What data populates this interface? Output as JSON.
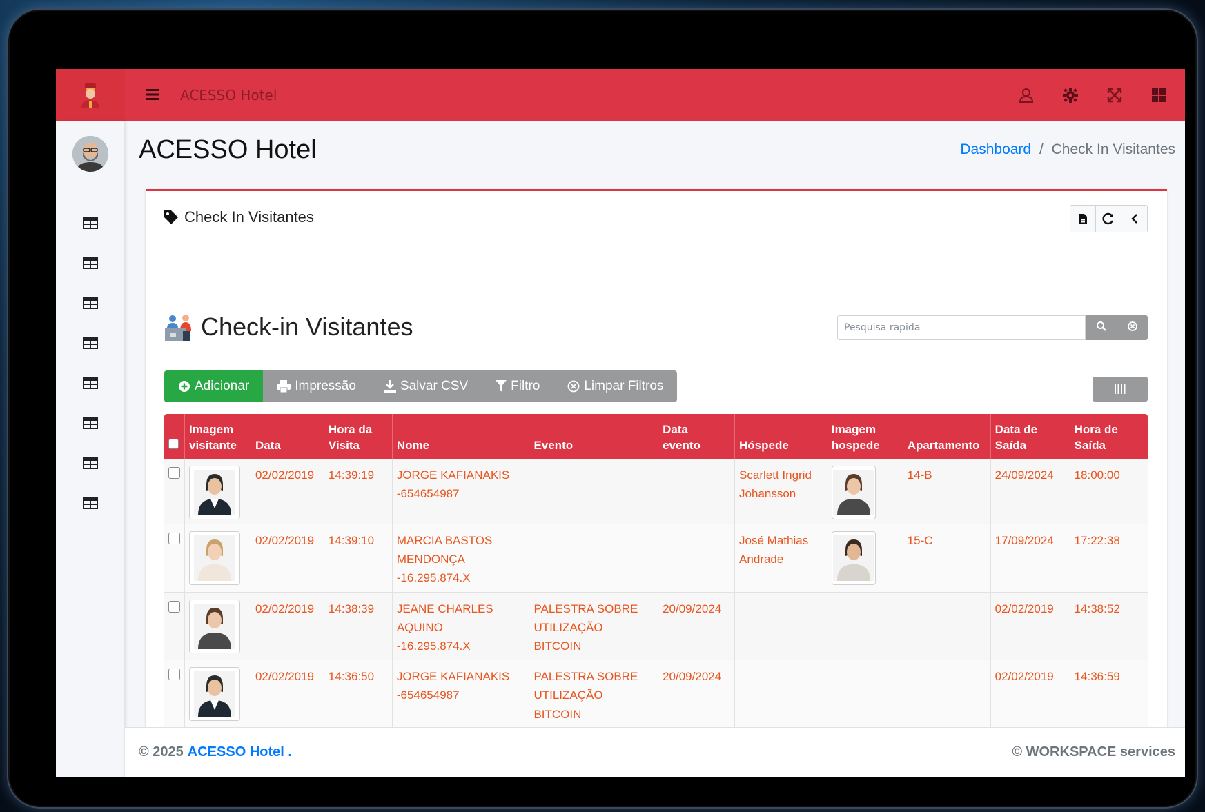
{
  "navbar": {
    "title": "ACESSO Hotel",
    "menu_icon": "hamburger-icon",
    "right_icons": [
      "user-icon",
      "gear-icon",
      "expand-icon",
      "apps-grid-icon"
    ],
    "accent": "#dc3545"
  },
  "sidebar": {
    "items": [
      "table-icon",
      "table-icon",
      "table-icon",
      "table-icon",
      "table-icon",
      "table-icon",
      "table-icon",
      "table-icon"
    ]
  },
  "header": {
    "title": "ACESSO Hotel",
    "breadcrumb": {
      "home": "Dashboard",
      "separator": "/",
      "current": "Check In Visitantes"
    }
  },
  "card": {
    "title": "Check In Visitantes",
    "tools": [
      "pdf-icon",
      "refresh-icon",
      "chevron-left-icon"
    ]
  },
  "grid": {
    "title": "Check-in Visitantes",
    "search": {
      "placeholder": "Pesquisa rapida"
    },
    "toolbar": {
      "add": "Adicionar",
      "print": "Impressão",
      "csv": "Salvar CSV",
      "filter": "Filtro",
      "clear": "Limpar Filtros"
    },
    "columns": [
      [
        "",
        ""
      ],
      [
        "Imagem",
        "visitante"
      ],
      [
        "",
        "Data"
      ],
      [
        "Hora da",
        "Visita"
      ],
      [
        "",
        "Nome"
      ],
      [
        "",
        "Evento"
      ],
      [
        "Data",
        "evento"
      ],
      [
        "",
        "Hóspede"
      ],
      [
        "Imagem",
        "hospede"
      ],
      [
        "",
        "Apartamento"
      ],
      [
        "Data de",
        "Saída"
      ],
      [
        "Hora de",
        "Saída"
      ]
    ],
    "rows": [
      {
        "data": "02/02/2019",
        "hora": "14:39:19",
        "nome": [
          "JORGE KAFIANAKIS",
          "-654654987"
        ],
        "evento": [],
        "data_evento": "",
        "hospede": [
          "Scarlett Ingrid",
          "Johansson"
        ],
        "apto": "14-B",
        "data_saida": "24/09/2024",
        "hora_saida": "18:00:00"
      },
      {
        "data": "02/02/2019",
        "hora": "14:39:10",
        "nome": [
          "MARCIA BASTOS",
          "MENDONÇA",
          "-16.295.874.X"
        ],
        "evento": [],
        "data_evento": "",
        "hospede": [
          "José Mathias",
          "Andrade"
        ],
        "apto": "15-C",
        "data_saida": "17/09/2024",
        "hora_saida": "17:22:38"
      },
      {
        "data": "02/02/2019",
        "hora": "14:38:39",
        "nome": [
          "JEANE CHARLES",
          "AQUINO",
          "-16.295.874.X"
        ],
        "evento": [
          "PALESTRA SOBRE",
          "UTILIZAÇÃO",
          "BITCOIN"
        ],
        "data_evento": "20/09/2024",
        "hospede": [],
        "apto": "",
        "data_saida": "02/02/2019",
        "hora_saida": "14:38:52"
      },
      {
        "data": "02/02/2019",
        "hora": "14:36:50",
        "nome": [
          "JORGE KAFIANAKIS",
          "-654654987"
        ],
        "evento": [
          "PALESTRA SOBRE",
          "UTILIZAÇÃO",
          "BITCOIN"
        ],
        "data_evento": "20/09/2024",
        "hospede": [],
        "apto": "",
        "data_saida": "02/02/2019",
        "hora_saida": "14:36:59"
      }
    ]
  },
  "footer": {
    "copyright": "© 2025",
    "brand": "ACESSO Hotel .",
    "right": "© WORKSPACE services"
  }
}
